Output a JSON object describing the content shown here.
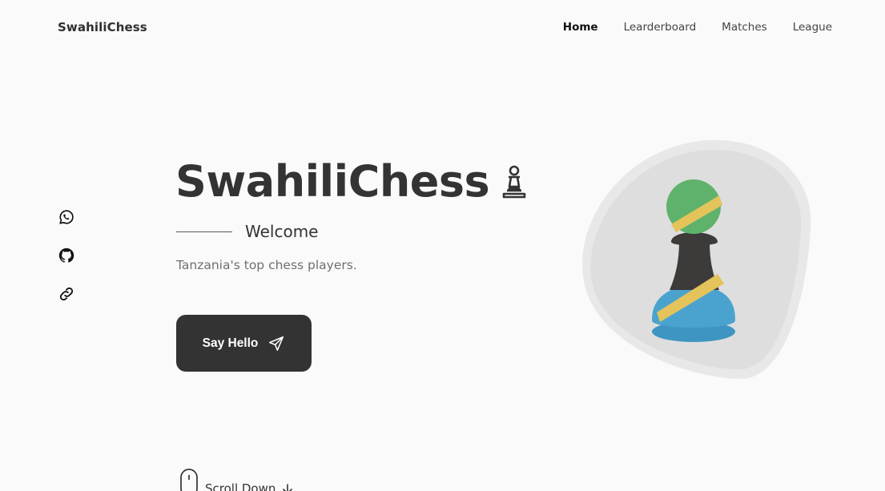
{
  "header": {
    "logo": "SwahiliChess",
    "nav": [
      {
        "label": "Home",
        "active": true
      },
      {
        "label": "Learderboard",
        "active": false
      },
      {
        "label": "Matches",
        "active": false
      },
      {
        "label": "League",
        "active": false
      }
    ]
  },
  "social": [
    {
      "icon": "whatsapp-icon"
    },
    {
      "icon": "github-icon"
    },
    {
      "icon": "link-icon"
    }
  ],
  "hero": {
    "title": "SwahiliChess",
    "title_icon": "chess-pawn-icon",
    "subtitle": "Welcome",
    "description": "Tanzania's top chess players.",
    "cta_label": "Say Hello",
    "cta_icon": "send-icon"
  },
  "scroll": {
    "label": "Scroll Down",
    "icon": "mouse-icon",
    "arrow_icon": "arrow-down-icon"
  },
  "colors": {
    "background": "#fafafa",
    "text": "#333333",
    "button": "#333333",
    "blob_outer": "#e7e7e7",
    "blob_inner": "#dedede",
    "tz_green": "#5fb26b",
    "tz_yellow": "#e3c35a",
    "tz_black": "#3d3a3a",
    "tz_blue": "#4aa3cf"
  }
}
